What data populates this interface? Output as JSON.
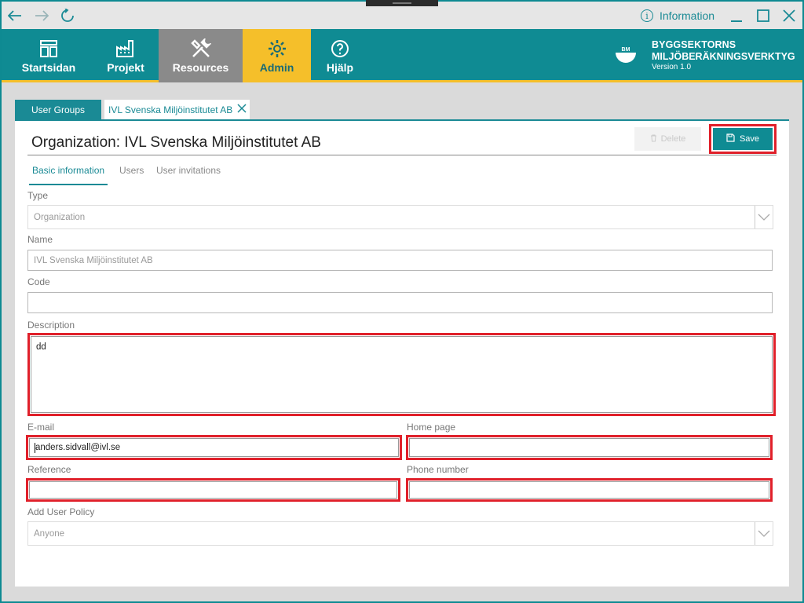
{
  "titlebar": {
    "info_label": "Information",
    "info_icon": "info-circle-icon"
  },
  "nav": {
    "items": [
      {
        "label": "Startsidan",
        "icon": "home-icon"
      },
      {
        "label": "Projekt",
        "icon": "factory-icon"
      },
      {
        "label": "Resources",
        "icon": "tools-icon"
      },
      {
        "label": "Admin",
        "icon": "gear-icon"
      },
      {
        "label": "Hjälp",
        "icon": "help-icon"
      }
    ],
    "active": "Admin",
    "colors": {
      "bar": "#0f8b93",
      "active": "#f5bf2a",
      "resources": "#8a8a8a"
    }
  },
  "brand": {
    "logo_text": "BM",
    "line1": "BYGGSEKTORNS",
    "line2": "MILJÖBERÄKNINGSVERKTYG",
    "version": "Version 1.0"
  },
  "pagetabs": {
    "groups": "User Groups",
    "org": "IVL Svenska Miljöinstitutet AB"
  },
  "page": {
    "title": "Organization: IVL Svenska Miljöinstitutet AB",
    "delete_label": "Delete",
    "save_label": "Save"
  },
  "subtabs": [
    "Basic information",
    "Users",
    "User invitations"
  ],
  "form": {
    "type_label": "Type",
    "type_value": "Organization",
    "name_label": "Name",
    "name_value": "IVL Svenska Miljöinstitutet AB",
    "code_label": "Code",
    "code_value": "",
    "description_label": "Description",
    "description_value": "dd",
    "email_label": "E-mail",
    "email_value": "anders.sidvall@ivl.se",
    "homepage_label": "Home page",
    "homepage_value": "",
    "reference_label": "Reference",
    "reference_value": "",
    "phone_label": "Phone number",
    "phone_value": "",
    "policy_label": "Add User Policy",
    "policy_value": "Anyone"
  }
}
